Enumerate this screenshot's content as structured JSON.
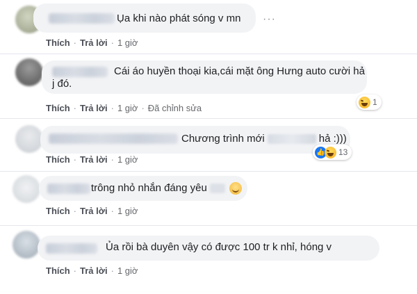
{
  "comments": [
    {
      "text": "Ụa khi nào phát sóng v mn",
      "actions": {
        "like": "Thích",
        "reply": "Trả lời",
        "time": "1 giờ"
      }
    },
    {
      "text_line1": "Cái áo huyền thoại kia,cái mặt ông Hưng auto cười hả",
      "text_line2": "j đó.",
      "actions": {
        "like": "Thích",
        "reply": "Trả lời",
        "time": "1 giờ",
        "edited": "Đã chỉnh sửa"
      },
      "reactions": {
        "icons": [
          "haha-icon"
        ],
        "count": "1"
      }
    },
    {
      "text_before": "Chương trình mới",
      "text_after": "hả :)))",
      "actions": {
        "like": "Thích",
        "reply": "Trả lời",
        "time": "1 giờ"
      },
      "reactions": {
        "icons": [
          "like-icon",
          "haha-icon"
        ],
        "count": "13"
      }
    },
    {
      "text": "trông nhỏ nhắn đáng yêu",
      "actions": {
        "like": "Thích",
        "reply": "Trả lời",
        "time": "1 giờ"
      }
    },
    {
      "text": "Ủa rồi bà duyên vậy có được 100 tr k nhỉ, hóng v",
      "actions": {
        "like": "Thích",
        "reply": "Trả lời",
        "time": "1 giờ"
      }
    }
  ],
  "menu_icon": "more-options-icon",
  "colors": {
    "bubble": "#f2f3f5",
    "action_text": "#4b4f56",
    "meta_text": "#65676b",
    "like_blue": "#1877f2",
    "haha_yellow": "#f7b125"
  }
}
